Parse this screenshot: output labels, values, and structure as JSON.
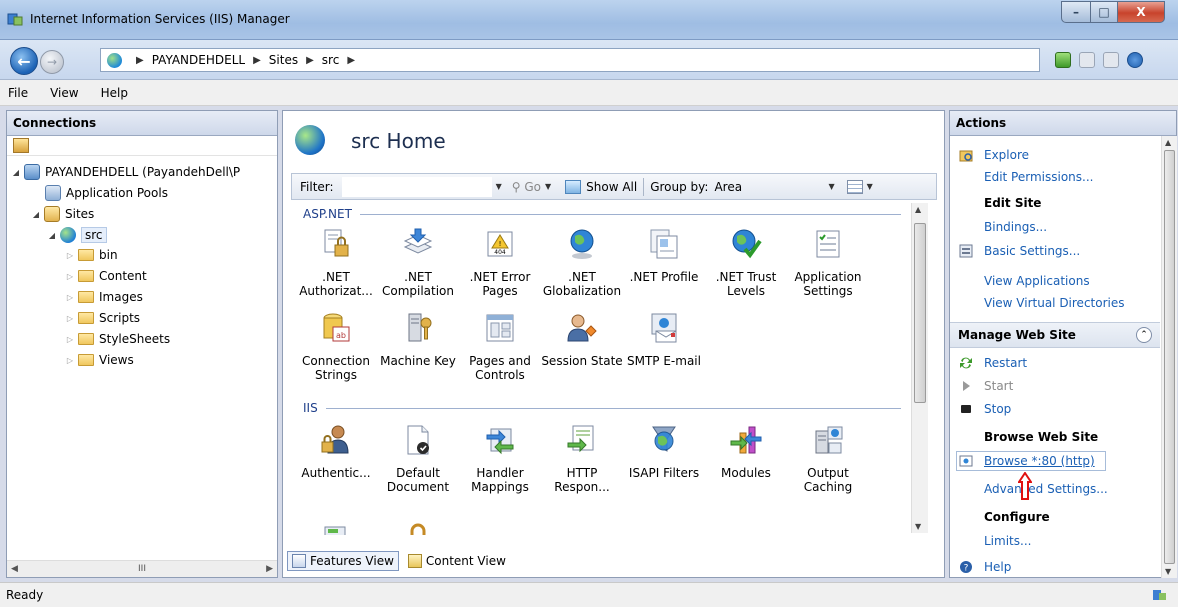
{
  "window": {
    "title": "Internet Information Services (IIS) Manager",
    "controls": {
      "minimize": "–",
      "maximize": "□",
      "close": "X"
    }
  },
  "address_bar": {
    "crumbs": [
      "PAYANDEHDELL",
      "Sites",
      "src"
    ]
  },
  "menu": [
    "File",
    "View",
    "Help"
  ],
  "connections": {
    "title": "Connections",
    "tree": [
      {
        "label": "PAYANDEHDELL (PayandehDell\\P",
        "level": 0,
        "expanded": true,
        "icon": "server-icon"
      },
      {
        "label": "Application Pools",
        "level": 1,
        "icon": "app-pool-icon"
      },
      {
        "label": "Sites",
        "level": 1,
        "expanded": true,
        "icon": "sites-icon"
      },
      {
        "label": "src",
        "level": 2,
        "expanded": true,
        "selected": true,
        "icon": "globe-icon"
      },
      {
        "label": "bin",
        "level": 3,
        "icon": "folder-icon"
      },
      {
        "label": "Content",
        "level": 3,
        "icon": "folder-icon"
      },
      {
        "label": "Images",
        "level": 3,
        "icon": "folder-icon"
      },
      {
        "label": "Scripts",
        "level": 3,
        "icon": "folder-icon"
      },
      {
        "label": "StyleSheets",
        "level": 3,
        "icon": "folder-icon"
      },
      {
        "label": "Views",
        "level": 3,
        "icon": "folder-icon"
      }
    ],
    "hscroll_thumb": "III"
  },
  "center": {
    "title": "src Home",
    "filter": {
      "label": "Filter:",
      "go": "Go",
      "show_all": "Show All",
      "group_by_label": "Group by:",
      "group_by_value": "Area"
    },
    "groups": [
      {
        "name": "ASP.NET",
        "features": [
          {
            "line1": ".NET",
            "line2": "Authorizat...",
            "icon": "authorization-icon"
          },
          {
            "line1": ".NET",
            "line2": "Compilation",
            "icon": "compilation-icon"
          },
          {
            "line1": ".NET Error",
            "line2": "Pages",
            "icon": "error-pages-icon"
          },
          {
            "line1": ".NET",
            "line2": "Globalization",
            "icon": "globalization-icon"
          },
          {
            "line1": ".NET Profile",
            "line2": "",
            "icon": "profile-icon"
          },
          {
            "line1": ".NET Trust",
            "line2": "Levels",
            "icon": "trust-levels-icon"
          },
          {
            "line1": "Application",
            "line2": "Settings",
            "icon": "app-settings-icon"
          },
          {
            "line1": "Connection",
            "line2": "Strings",
            "icon": "connection-strings-icon"
          },
          {
            "line1": "Machine Key",
            "line2": "",
            "icon": "machine-key-icon"
          },
          {
            "line1": "Pages and",
            "line2": "Controls",
            "icon": "pages-controls-icon"
          },
          {
            "line1": "Session State",
            "line2": "",
            "icon": "session-state-icon"
          },
          {
            "line1": "SMTP E-mail",
            "line2": "",
            "icon": "smtp-icon"
          }
        ]
      },
      {
        "name": "IIS",
        "features": [
          {
            "line1": "Authentic...",
            "line2": "",
            "icon": "authentication-icon"
          },
          {
            "line1": "Default",
            "line2": "Document",
            "icon": "default-document-icon"
          },
          {
            "line1": "Handler",
            "line2": "Mappings",
            "icon": "handler-mappings-icon"
          },
          {
            "line1": "HTTP",
            "line2": "Respon...",
            "icon": "http-response-icon"
          },
          {
            "line1": "ISAPI Filters",
            "line2": "",
            "icon": "isapi-filters-icon"
          },
          {
            "line1": "Modules",
            "line2": "",
            "icon": "modules-icon"
          },
          {
            "line1": "Output",
            "line2": "Caching",
            "icon": "output-caching-icon"
          }
        ]
      }
    ],
    "tabs": {
      "features_view": "Features View",
      "content_view": "Content View"
    }
  },
  "actions": {
    "title": "Actions",
    "explore": "Explore",
    "edit_permissions": "Edit Permissions...",
    "edit_site": "Edit Site",
    "bindings": "Bindings...",
    "basic_settings": "Basic Settings...",
    "view_applications": "View Applications",
    "view_virtual_directories": "View Virtual Directories",
    "manage_web_site": "Manage Web Site",
    "restart": "Restart",
    "start": "Start",
    "stop": "Stop",
    "browse_web_site": "Browse Web Site",
    "browse": "Browse *:80 (http)",
    "advanced_settings": "Advanced Settings...",
    "configure": "Configure",
    "limits": "Limits...",
    "help": "Help"
  },
  "status": {
    "text": "Ready"
  },
  "colors": {
    "link": "#1a5fb4",
    "group_header": "#1f3f8a",
    "annotation_arrow": "#e01010"
  }
}
